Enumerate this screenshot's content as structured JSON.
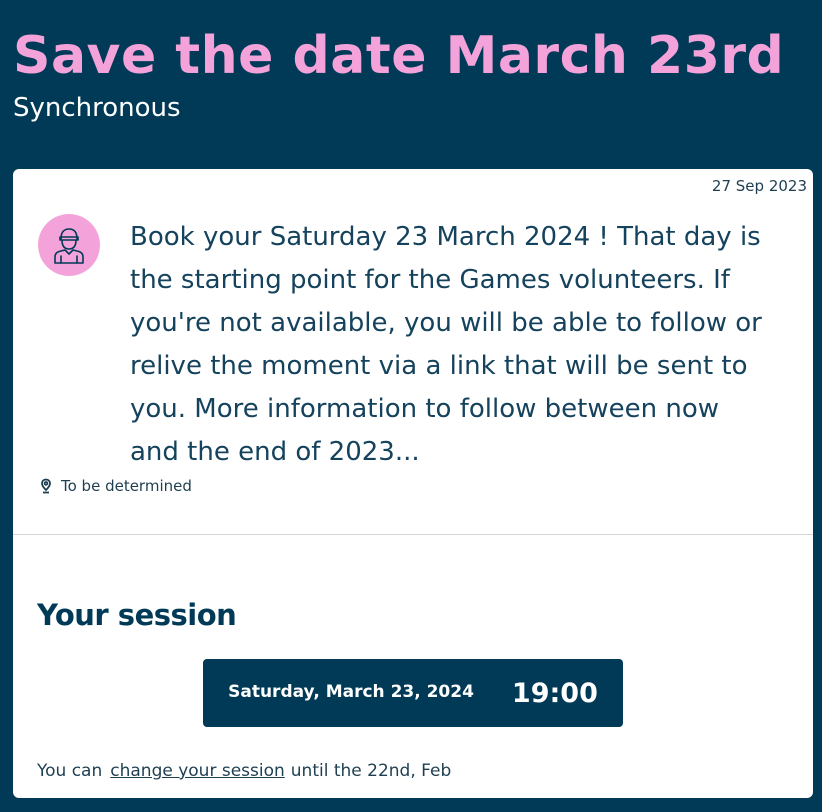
{
  "header": {
    "title": "Save the date March 23rd",
    "subtitle": "Synchronous"
  },
  "post": {
    "date": "27 Sep 2023",
    "avatar_icon": "volunteer-icon",
    "message": "Book your Saturday 23 March 2024 ! That day is the starting point for the Games volunteers. If you're not available, you will be able to follow or relive the moment via a link that will be sent to you. More information to follow between now and the end of 2023...",
    "location_icon": "map-pin-icon",
    "location": "To be determined"
  },
  "session": {
    "title": "Your session",
    "date": "Saturday, March 23, 2024",
    "time": "19:00",
    "note_prefix": "You can",
    "note_link": "change your session",
    "note_suffix": "until the 22nd, Feb"
  },
  "colors": {
    "background": "#003a57",
    "accent_pink": "#f4a3da",
    "card": "#ffffff",
    "text": "#15425c"
  }
}
